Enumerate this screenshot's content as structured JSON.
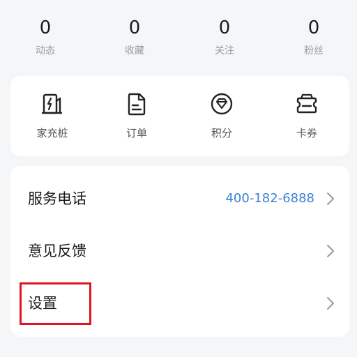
{
  "stats": [
    {
      "value": "0",
      "label": "动态"
    },
    {
      "value": "0",
      "label": "收藏"
    },
    {
      "value": "0",
      "label": "关注"
    },
    {
      "value": "0",
      "label": "粉丝"
    }
  ],
  "quick_actions": [
    {
      "label": "家充桩",
      "icon": "charger-icon"
    },
    {
      "label": "订单",
      "icon": "order-document-icon"
    },
    {
      "label": "积分",
      "icon": "points-diamond-icon"
    },
    {
      "label": "卡券",
      "icon": "coupon-ticket-icon"
    }
  ],
  "menu": [
    {
      "label": "服务电话",
      "value": "400-182-6888"
    },
    {
      "label": "意见反馈",
      "value": ""
    },
    {
      "label": "设置",
      "value": ""
    }
  ],
  "colors": {
    "background": "#f5f6f8",
    "card": "#ffffff",
    "link": "#3b82d6",
    "highlight": "#e0141e"
  }
}
